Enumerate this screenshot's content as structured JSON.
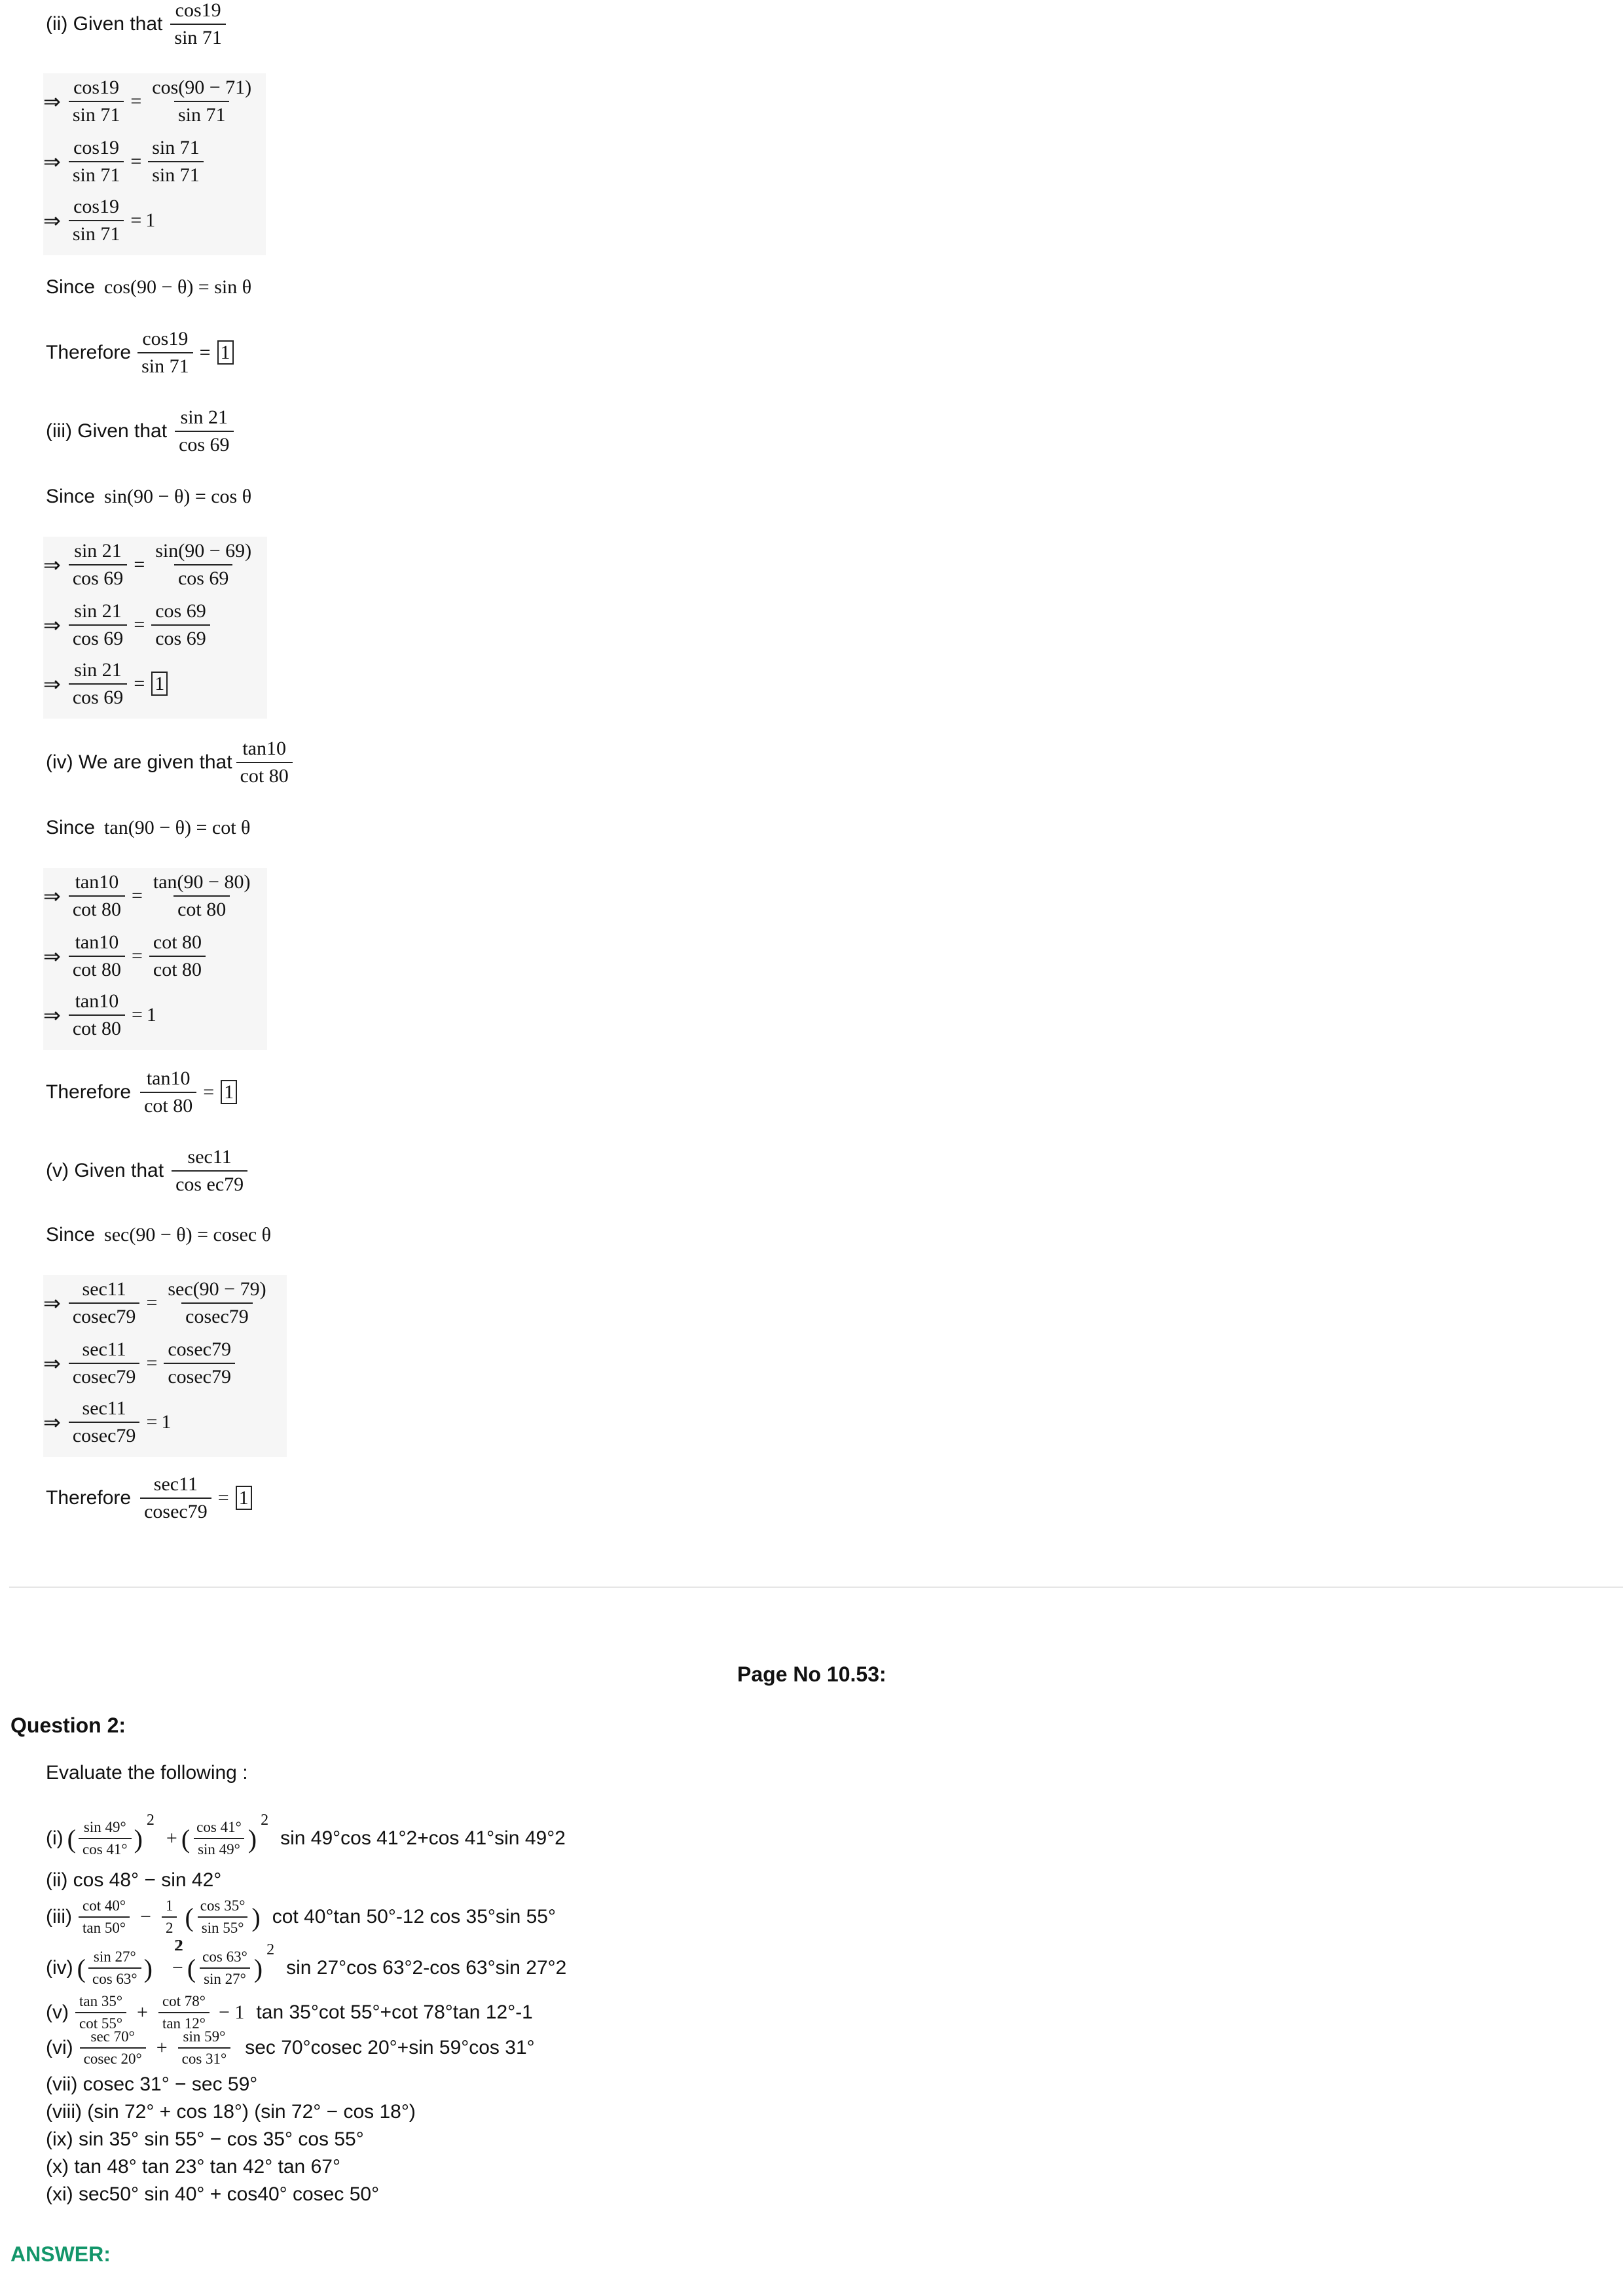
{
  "part_ii": {
    "given_label": "(ii) Given that",
    "given_num": "cos19",
    "given_den": "sin 71",
    "step1_lhs_num": "cos19",
    "step1_lhs_den": "sin 71",
    "step1_rhs_num": "cos(90 − 71)",
    "step1_rhs_den": "sin 71",
    "step2_lhs_num": "cos19",
    "step2_lhs_den": "sin 71",
    "step2_rhs_num": "sin 71",
    "step2_rhs_den": "sin 71",
    "step3_num": "cos19",
    "step3_den": "sin 71",
    "step3_val": "1",
    "since_label": "Since",
    "since_expr": "cos(90 − θ) = sin θ",
    "therefore_label": "Therefore",
    "therefore_num": "cos19",
    "therefore_den": "sin 71",
    "therefore_val": "1"
  },
  "part_iii": {
    "given_label": "(iii) Given that",
    "given_num": "sin 21",
    "given_den": "cos 69",
    "since_label": "Since",
    "since_expr": "sin(90 − θ) = cos θ",
    "step1_lhs_num": "sin 21",
    "step1_lhs_den": "cos 69",
    "step1_rhs_num": "sin(90 − 69)",
    "step1_rhs_den": "cos 69",
    "step2_lhs_num": "sin 21",
    "step2_lhs_den": "cos 69",
    "step2_rhs_num": "cos 69",
    "step2_rhs_den": "cos 69",
    "step3_num": "sin 21",
    "step3_den": "cos 69",
    "step3_val": "1"
  },
  "part_iv": {
    "given_label": "(iv) We are given that",
    "given_num": "tan10",
    "given_den": "cot 80",
    "since_label": "Since",
    "since_expr": "tan(90 − θ) = cot θ",
    "step1_lhs_num": "tan10",
    "step1_lhs_den": "cot 80",
    "step1_rhs_num": "tan(90 − 80)",
    "step1_rhs_den": "cot 80",
    "step2_lhs_num": "tan10",
    "step2_lhs_den": "cot 80",
    "step2_rhs_num": "cot 80",
    "step2_rhs_den": "cot 80",
    "step3_num": "tan10",
    "step3_den": "cot 80",
    "step3_val": "1",
    "therefore_label": "Therefore",
    "therefore_num": "tan10",
    "therefore_den": "cot 80",
    "therefore_val": "1"
  },
  "part_v": {
    "given_label": "(v) Given that",
    "given_num": "sec11",
    "given_den": "cos ec79",
    "since_label": "Since",
    "since_expr": "sec(90 − θ) = cosec θ",
    "step1_lhs_num": "sec11",
    "step1_lhs_den": "cosec79",
    "step1_rhs_num": "sec(90 − 79)",
    "step1_rhs_den": "cosec79",
    "step2_lhs_num": "sec11",
    "step2_lhs_den": "cosec79",
    "step2_rhs_num": "cosec79",
    "step2_rhs_den": "cosec79",
    "step3_num": "sec11",
    "step3_den": "cosec79",
    "step3_val": "1",
    "therefore_label": "Therefore",
    "therefore_num": "sec11",
    "therefore_den": "cosec79",
    "therefore_val": "1"
  },
  "symbols": {
    "implies": "⇒",
    "equals": "=",
    "plus": "+",
    "minus": "−",
    "open": "(",
    "close": ")"
  },
  "page_no": "Page No 10.53:",
  "question": {
    "title": "Question 2:",
    "intro": "Evaluate the following :",
    "i": {
      "label": "(i)",
      "f1_num": "sin 49°",
      "f1_den": "cos 41°",
      "exp1": "2",
      "f2_num": "cos 41°",
      "f2_den": "sin 49°",
      "exp2": "2",
      "plain": "sin 49°cos 41°2+cos 41°sin 49°2"
    },
    "ii": {
      "text": "(ii) cos 48° − sin 42°"
    },
    "iii": {
      "label": "(iii)",
      "f1_num": "cot 40°",
      "f1_den": "tan 50°",
      "f2_num": "1",
      "f2_den": "2",
      "f3_num": "cos 35°",
      "f3_den": "sin 55°",
      "exp3": "2",
      "plain": "cot 40°tan 50°-12 cos 35°sin 55°"
    },
    "iv": {
      "label": "(iv)",
      "f1_num": "sin 27°",
      "f1_den": "cos 63°",
      "exp1": "2",
      "f2_num": "cos 63°",
      "f2_den": "sin 27°",
      "exp2": "2",
      "plain": "sin 27°cos 63°2-cos 63°sin 27°2"
    },
    "v": {
      "label": "(v)",
      "f1_num": "tan 35°",
      "f1_den": "cot 55°",
      "f2_num": "cot 78°",
      "f2_den": "tan 12°",
      "tail": "− 1",
      "plain": "tan 35°cot 55°+cot 78°tan 12°-1"
    },
    "vi": {
      "label": "(vi)",
      "f1_num": "sec 70°",
      "f1_den": "cosec 20°",
      "f2_num": "sin 59°",
      "f2_den": "cos 31°",
      "plain": "sec 70°cosec 20°+sin 59°cos 31°"
    },
    "vii": {
      "text": "(vii) cosec 31° − sec 59°"
    },
    "viii": {
      "text": "(viii) (sin 72° + cos 18°) (sin 72° − cos 18°)"
    },
    "ix": {
      "text": "(ix) sin 35° sin 55° − cos 35° cos 55°"
    },
    "x": {
      "text": "(x) tan 48° tan 23° tan 42° tan 67°"
    },
    "xi": {
      "text": "(xi) sec50° sin 40° + cos40° cosec 50°"
    }
  },
  "answer_label": "ANSWER:",
  "colors": {
    "answer": "#13966a",
    "block_bg": "#f6f6f6",
    "divider": "#e6e6e6"
  }
}
